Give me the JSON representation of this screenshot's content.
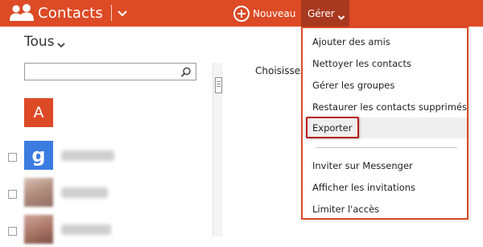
{
  "app": {
    "title": "Contacts",
    "icon": "people-icon",
    "accent_color": "#dc4a26",
    "accent_dark_color": "#a93820"
  },
  "toolbar": {
    "new_label": "Nouveau",
    "manage_label": "Gérer"
  },
  "filter": {
    "label": "Tous"
  },
  "search": {
    "value": "",
    "placeholder": ""
  },
  "list": {
    "letter": "A",
    "google_glyph": "g"
  },
  "main": {
    "prompt": "Choisissez"
  },
  "menu": {
    "items": [
      {
        "label": "Ajouter des amis"
      },
      {
        "label": "Nettoyer les contacts"
      },
      {
        "label": "Gérer les groupes"
      },
      {
        "label": "Restaurer les contacts supprimés"
      },
      {
        "label": "Exporter"
      },
      {
        "label": "Inviter sur Messenger"
      },
      {
        "label": "Afficher les invitations"
      },
      {
        "label": "Limiter l'accès"
      }
    ],
    "highlighted_item": "Exporter"
  }
}
